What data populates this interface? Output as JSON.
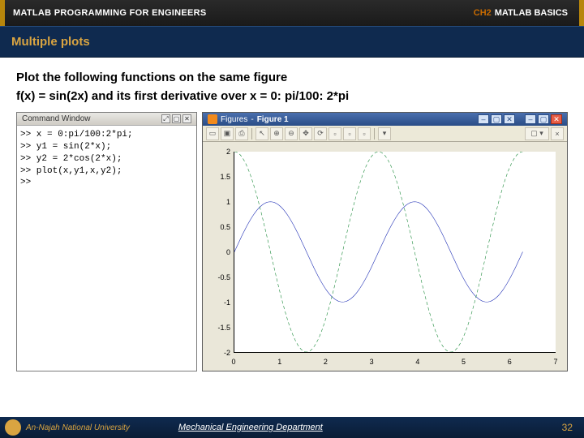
{
  "topbar": {
    "left": "MATLAB PROGRAMMING FOR ENGINEERS",
    "ch": "CH2",
    "right": "MATLAB BASICS"
  },
  "subtitle": "Multiple plots",
  "task": {
    "l1": "Plot the following functions on the same figure",
    "l2": "f(x) = sin(2x) and its first derivative over x = 0: pi/100: 2*pi"
  },
  "cmd": {
    "title": "Command Window",
    "btn_undock": "⤢",
    "btn_min": "▢",
    "btn_close": "✕",
    "lines": [
      ">> x = 0:pi/100:2*pi;",
      ">> y1 = sin(2*x);",
      ">> y2 = 2*cos(2*x);",
      ">> plot(x,y1,x,y2);",
      ">> "
    ]
  },
  "fig": {
    "brand": "Figures",
    "title": "Figure 1",
    "btn_min": "–",
    "btn_max": "▢",
    "btn_close": "✕",
    "tools": [
      "▭",
      "▣",
      "⎙",
      "",
      "↖",
      "⊕",
      "⊖",
      "✥",
      "⟳",
      "▫",
      "▫",
      "▫",
      "",
      "▾"
    ]
  },
  "chart_data": {
    "type": "line",
    "xlabel": "",
    "ylabel": "",
    "xlim": [
      0,
      7
    ],
    "ylim": [
      -2,
      2
    ],
    "xticks": [
      0,
      1,
      2,
      3,
      4,
      5,
      6,
      7
    ],
    "yticks": [
      -2,
      -1.5,
      -1,
      -0.5,
      0,
      0.5,
      1,
      1.5,
      2
    ],
    "series": [
      {
        "name": "sin(2x)",
        "color": "#1f2fb5",
        "style": "solid",
        "fn": "sin2x"
      },
      {
        "name": "2cos(2x)",
        "color": "#1b8a3a",
        "style": "dashed",
        "fn": "2cos2x"
      }
    ]
  },
  "footer": {
    "university": "An-Najah National University",
    "dept": "Mechanical Engineering Department",
    "page": "32"
  }
}
